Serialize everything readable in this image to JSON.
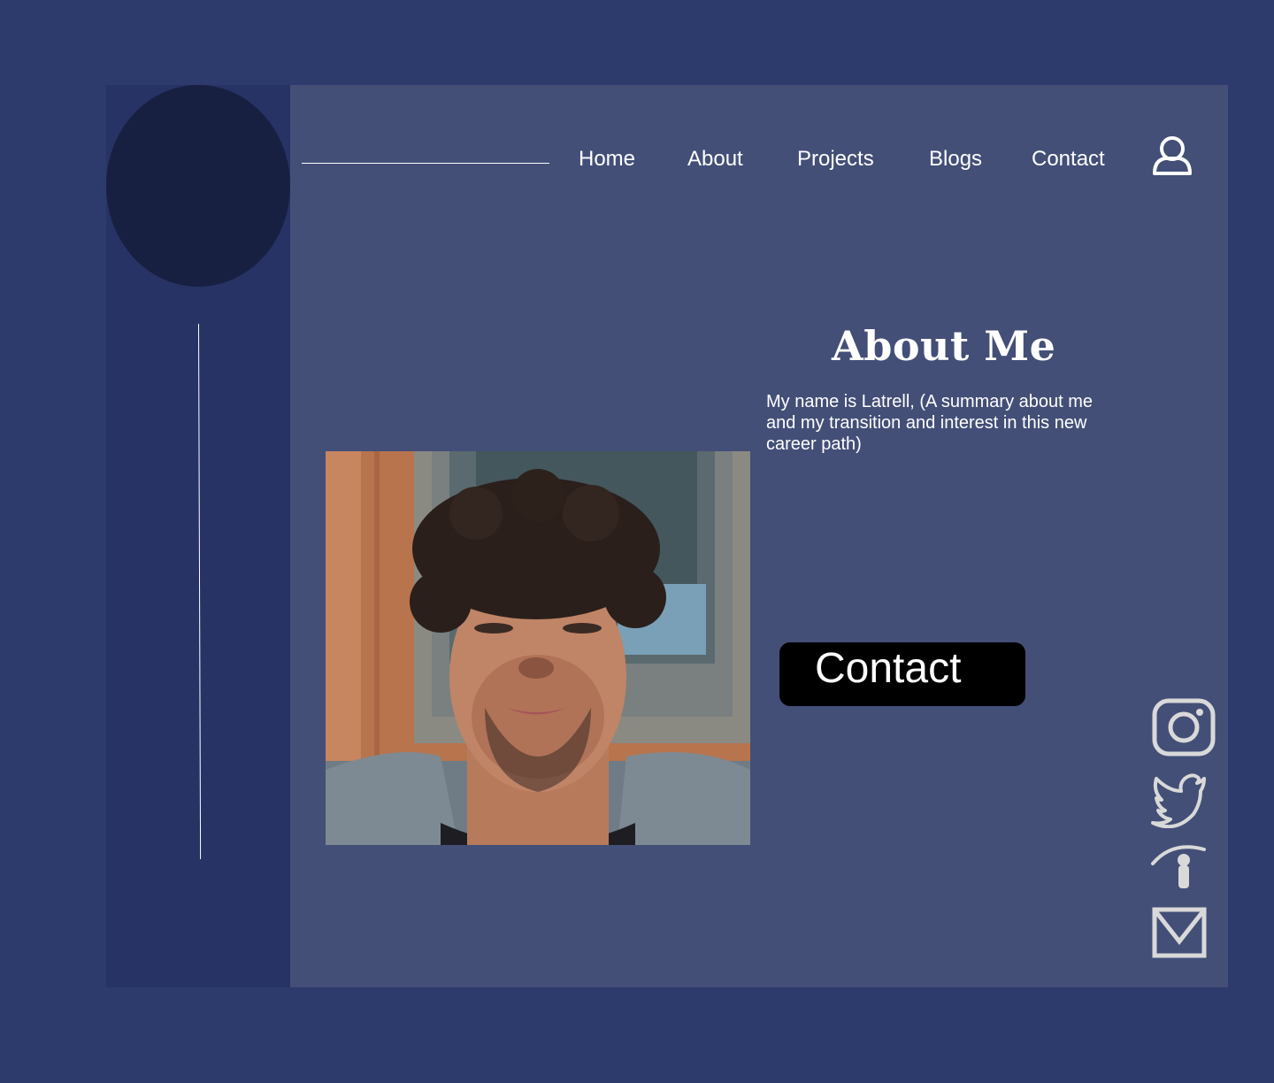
{
  "nav": {
    "items": [
      {
        "label": "Home"
      },
      {
        "label": "About"
      },
      {
        "label": "Projects"
      },
      {
        "label": "Blogs"
      },
      {
        "label": "Contact"
      }
    ]
  },
  "icons": {
    "user": "user-icon",
    "instagram": "instagram-icon",
    "twitter": "twitter-icon",
    "indeed": "indeed-icon",
    "email": "mail-icon"
  },
  "about": {
    "title": "About Me",
    "text": "My name is Latrell, (A summary about me and my transition and interest in this new career path)"
  },
  "contact_button": {
    "label": "Contact"
  },
  "colors": {
    "page_bg": "#2d3a6c",
    "sidebar_bg": "#263364",
    "logo_circle": "#182042",
    "main_bg": "#434f77",
    "button_bg": "#000000",
    "icon_gray": "#d9d9d9"
  }
}
